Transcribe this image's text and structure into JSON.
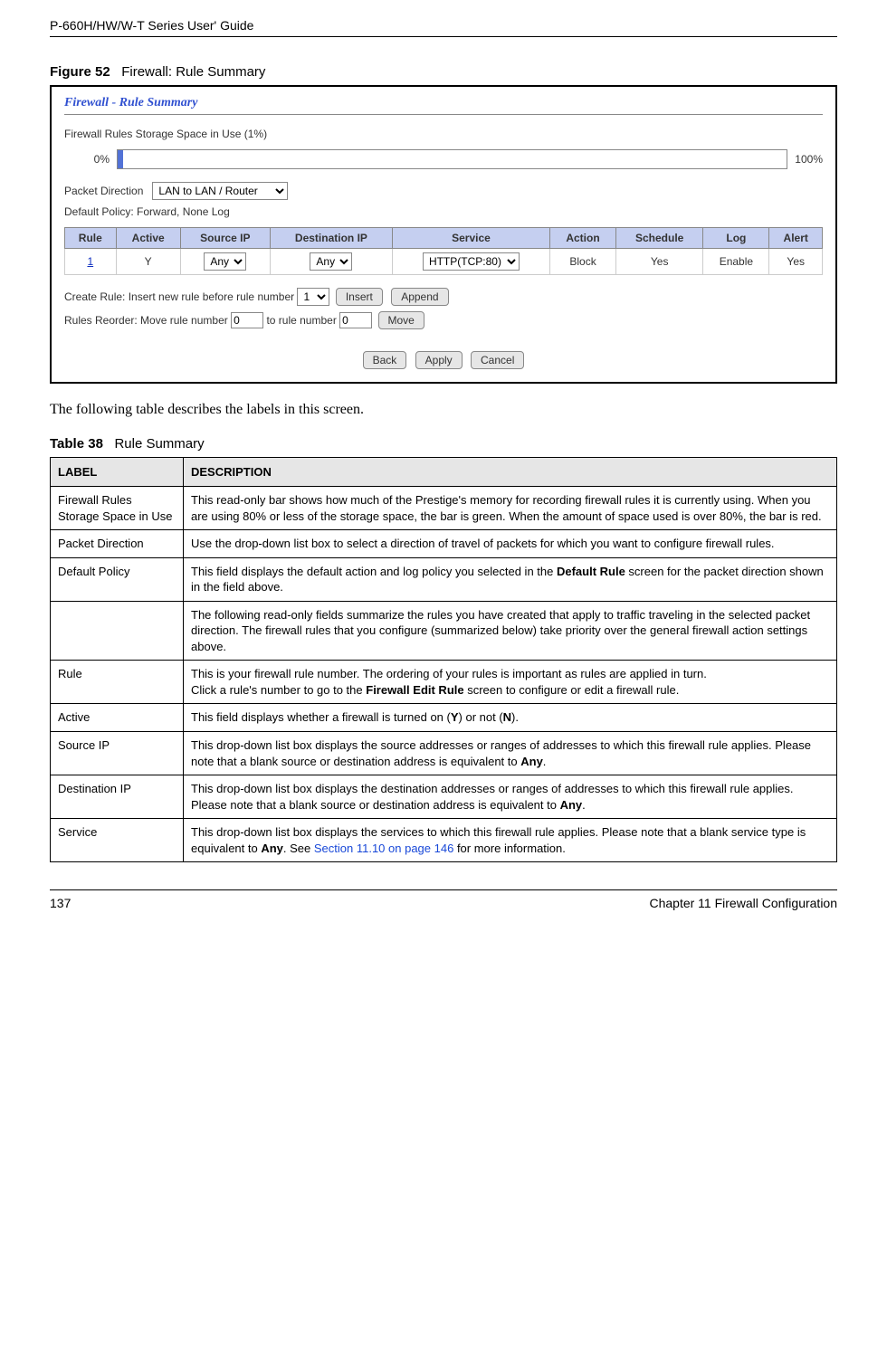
{
  "header": {
    "guide_title": "P-660H/HW/W-T Series User' Guide"
  },
  "figure": {
    "label": "Figure 52",
    "caption": "Firewall: Rule Summary"
  },
  "screenshot": {
    "title": "Firewall - Rule Summary",
    "storage_label": "Firewall Rules Storage Space in Use  (1%)",
    "pct_left": "0%",
    "pct_right": "100%",
    "packet_direction_label": "Packet Direction",
    "packet_direction_value": "LAN to LAN / Router",
    "default_policy_label": "Default Policy: Forward, None Log",
    "headers": {
      "rule": "Rule",
      "active": "Active",
      "source": "Source IP",
      "dest": "Destination IP",
      "service": "Service",
      "action": "Action",
      "schedule": "Schedule",
      "log": "Log",
      "alert": "Alert"
    },
    "row1": {
      "rule": "1",
      "active": "Y",
      "source": "Any",
      "dest": "Any",
      "service": "HTTP(TCP:80)",
      "action": "Block",
      "schedule": "Yes",
      "log": "Enable",
      "alert": "Yes"
    },
    "create_rule_label": "Create Rule: Insert new rule before rule number",
    "create_rule_value": "1",
    "insert_btn": "Insert",
    "append_btn": "Append",
    "reorder_label_a": "Rules Reorder: Move rule number",
    "reorder_val_a": "0",
    "reorder_label_b": "to rule number",
    "reorder_val_b": "0",
    "move_btn": "Move",
    "back_btn": "Back",
    "apply_btn": "Apply",
    "cancel_btn": "Cancel"
  },
  "body_text": "The following table describes the labels in this screen.",
  "table38": {
    "label": "Table 38",
    "caption": "Rule Summary",
    "hdr_label": "LABEL",
    "hdr_desc": "DESCRIPTION",
    "rows": {
      "r0_label": "Firewall Rules Storage Space in Use",
      "r0_desc": "This read-only bar shows how much of the Prestige's memory for recording firewall rules it is currently using. When you are using 80% or less of the storage space, the bar is green. When the amount of space used is over 80%, the bar is red.",
      "r1_label": "Packet Direction",
      "r1_desc": "Use the drop-down list box to select a direction of travel of packets for which you want to configure firewall rules.",
      "r2_label": "Default Policy",
      "r2_desc_a": "This field displays the default action and log policy you selected in the ",
      "r2_desc_bold": "Default Rule",
      "r2_desc_b": " screen for the packet direction shown in the field above.",
      "r3_label": "",
      "r3_desc": "The following read-only fields summarize the rules you have created that apply to traffic traveling in the selected packet direction. The firewall rules that you configure (summarized below) take priority over the general firewall action settings above.",
      "r4_label": "Rule",
      "r4_desc_a": "This is your firewall rule number. The ordering of your rules is important as rules are applied in turn.",
      "r4_desc_b1": "Click a rule's number to go to the ",
      "r4_desc_bold": "Firewall Edit Rule",
      "r4_desc_b2": " screen to configure or edit a firewall rule.",
      "r5_label": "Active",
      "r5_desc_a": "This field displays whether a firewall is turned on (",
      "r5_y": "Y",
      "r5_desc_b": ") or not (",
      "r5_n": "N",
      "r5_desc_c": ").",
      "r6_label": "Source IP",
      "r6_desc_a": "This drop-down list box displays the source addresses or ranges of addresses to which this firewall rule applies. Please note that a blank source or destination address is equivalent to ",
      "r6_any": "Any",
      "r6_desc_b": ".",
      "r7_label": "Destination IP",
      "r7_desc_a": "This drop-down list box displays the destination addresses or ranges of addresses to which this firewall rule applies. Please note that a blank source or destination address is equivalent to ",
      "r7_any": "Any",
      "r7_desc_b": ".",
      "r8_label": "Service",
      "r8_desc_a": "This drop-down list box displays the services to which this firewall rule applies. Please note that a blank service type is equivalent to ",
      "r8_any": "Any",
      "r8_desc_b": ". See ",
      "r8_link": "Section 11.10 on page 146",
      "r8_desc_c": " for more information."
    }
  },
  "footer": {
    "page": "137",
    "chapter": "Chapter 11 Firewall Configuration"
  }
}
